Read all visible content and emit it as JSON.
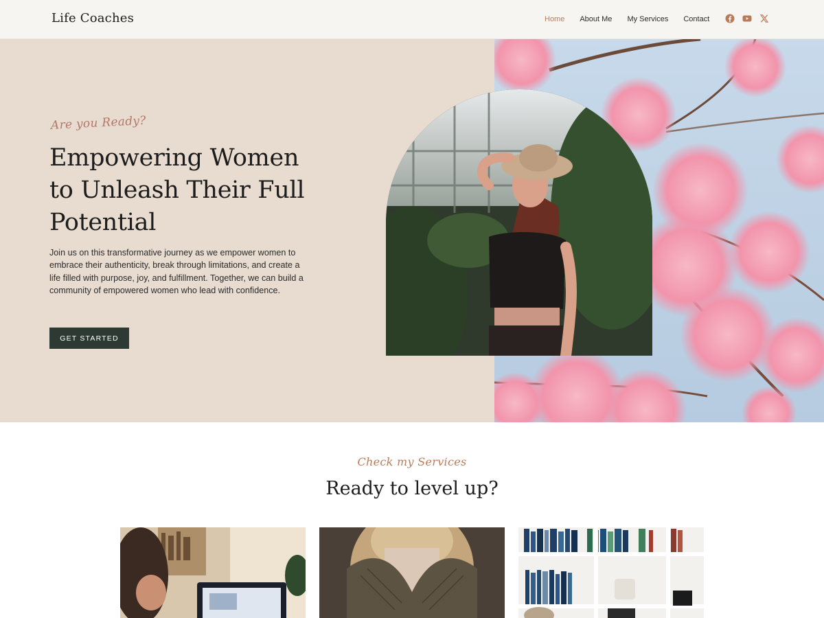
{
  "header": {
    "logo": "Life Coaches",
    "nav": [
      "Home",
      "About Me",
      "My Services",
      "Contact"
    ],
    "active_nav": "Home",
    "social_icons": [
      "facebook-icon",
      "youtube-icon",
      "x-icon"
    ]
  },
  "hero": {
    "kicker": "Are you Ready?",
    "title": "Empowering Women to Unleash Their Full Potential",
    "text": "Join us on this transformative journey as we empower women to embrace their authenticity, break through limitations, and create a life filled with purpose, joy, and fulfillment. Together, we can build a community of empowered women who lead with confidence.",
    "cta_label": "GET STARTED"
  },
  "services": {
    "kicker": "Check my Services",
    "title": "Ready to level up?"
  },
  "colors": {
    "hero_bg": "#e8dcd0",
    "header_bg": "#f7f5f1",
    "accent": "#b97c5a",
    "button": "#2c3a33"
  }
}
